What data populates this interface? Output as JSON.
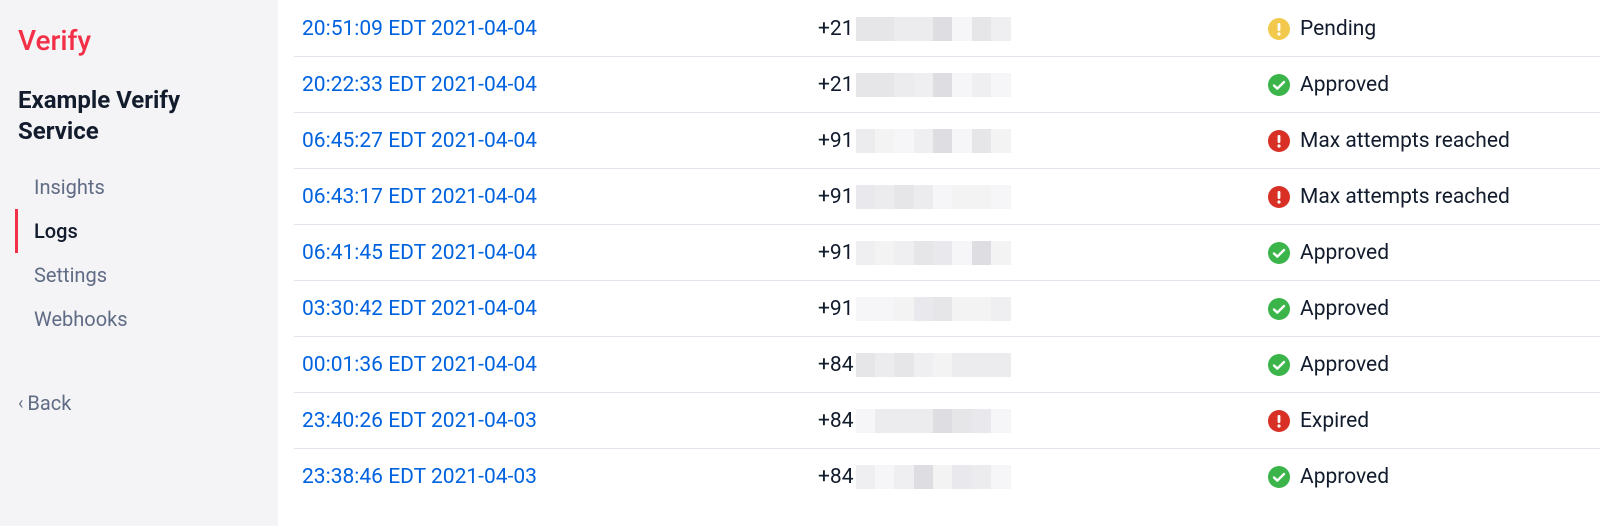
{
  "sidebar": {
    "brand": "Verify",
    "service_title": "Example Verify Service",
    "nav": [
      {
        "label": "Insights",
        "active": false
      },
      {
        "label": "Logs",
        "active": true
      },
      {
        "label": "Settings",
        "active": false
      },
      {
        "label": "Webhooks",
        "active": false
      }
    ],
    "back_label": "Back"
  },
  "status_colors": {
    "pending": "#f2c94c",
    "approved": "#3bb54a",
    "error": "#d93025"
  },
  "logs": [
    {
      "timestamp": "20:51:09 EDT 2021-04-04",
      "phone_prefix": "+21",
      "status": "pending",
      "status_label": "Pending"
    },
    {
      "timestamp": "20:22:33 EDT 2021-04-04",
      "phone_prefix": "+21",
      "status": "approved",
      "status_label": "Approved"
    },
    {
      "timestamp": "06:45:27 EDT 2021-04-04",
      "phone_prefix": "+91",
      "status": "error",
      "status_label": "Max attempts reached"
    },
    {
      "timestamp": "06:43:17 EDT 2021-04-04",
      "phone_prefix": "+91",
      "status": "error",
      "status_label": "Max attempts reached"
    },
    {
      "timestamp": "06:41:45 EDT 2021-04-04",
      "phone_prefix": "+91",
      "status": "approved",
      "status_label": "Approved"
    },
    {
      "timestamp": "03:30:42 EDT 2021-04-04",
      "phone_prefix": "+91",
      "status": "approved",
      "status_label": "Approved"
    },
    {
      "timestamp": "00:01:36 EDT 2021-04-04",
      "phone_prefix": "+84",
      "status": "approved",
      "status_label": "Approved"
    },
    {
      "timestamp": "23:40:26 EDT 2021-04-03",
      "phone_prefix": "+84",
      "status": "error",
      "status_label": "Expired"
    },
    {
      "timestamp": "23:38:46 EDT 2021-04-03",
      "phone_prefix": "+84",
      "status": "approved",
      "status_label": "Approved"
    }
  ]
}
